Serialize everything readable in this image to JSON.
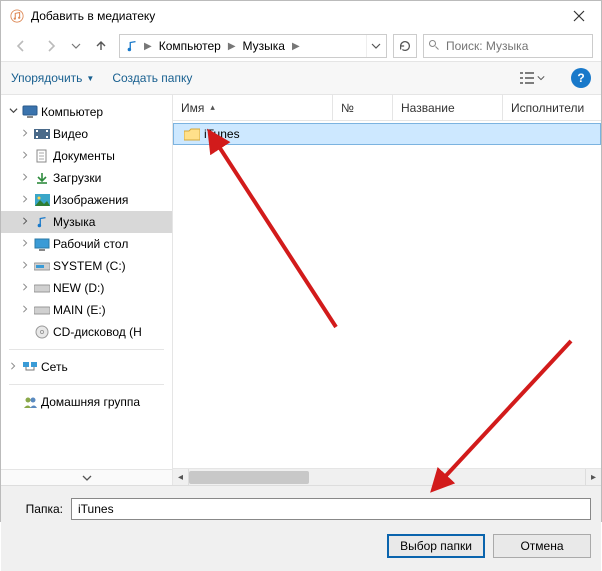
{
  "window": {
    "title": "Добавить в медиатеку"
  },
  "nav": {
    "breadcrumb": {
      "root": "Компьютер",
      "folder": "Музыка"
    },
    "search_placeholder": "Поиск: Музыка"
  },
  "toolbar": {
    "organize": "Упорядочить",
    "new_folder": "Создать папку"
  },
  "columns": {
    "name": "Имя",
    "number": "№",
    "title": "Название",
    "artist": "Исполнители"
  },
  "sidebar": {
    "computer": "Компьютер",
    "items": [
      {
        "label": "Видео"
      },
      {
        "label": "Документы"
      },
      {
        "label": "Загрузки"
      },
      {
        "label": "Изображения"
      },
      {
        "label": "Музыка"
      },
      {
        "label": "Рабочий стол"
      },
      {
        "label": "SYSTEM (C:)"
      },
      {
        "label": "NEW (D:)"
      },
      {
        "label": "MAIN (E:)"
      },
      {
        "label": "CD-дисковод (H"
      }
    ],
    "network": "Сеть",
    "homegroup": "Домашняя группа"
  },
  "files": {
    "rows": [
      {
        "name": "iTunes"
      }
    ]
  },
  "footer": {
    "folder_label": "Папка:",
    "folder_value": "iTunes",
    "select_button": "Выбор папки",
    "cancel_button": "Отмена"
  },
  "colors": {
    "accent": "#0a64ad",
    "annotation": "#d21b1b"
  }
}
